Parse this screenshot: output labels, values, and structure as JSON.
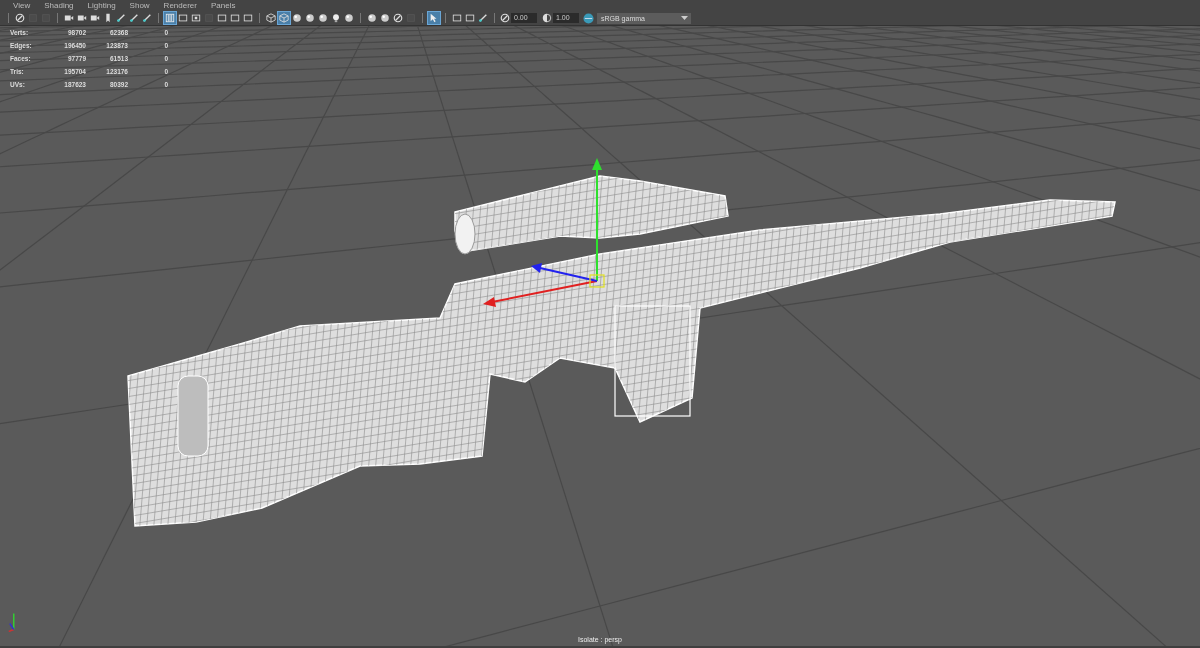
{
  "menu": [
    {
      "label": "View"
    },
    {
      "label": "Shading"
    },
    {
      "label": "Lighting"
    },
    {
      "label": "Show"
    },
    {
      "label": "Renderer"
    },
    {
      "label": "Panels"
    }
  ],
  "toolbar": {
    "groups": [
      [
        {
          "kind": "circle",
          "selected": false
        },
        {
          "kind": "dim",
          "selected": false
        },
        {
          "kind": "dim",
          "selected": false
        }
      ],
      [
        {
          "kind": "camera",
          "selected": false
        },
        {
          "kind": "camera",
          "selected": false
        },
        {
          "kind": "camera",
          "selected": false
        },
        {
          "kind": "bookmark",
          "selected": false
        },
        {
          "kind": "pen",
          "selected": false
        },
        {
          "kind": "pen",
          "selected": false
        },
        {
          "kind": "pen",
          "selected": false
        }
      ],
      [
        {
          "kind": "grid",
          "selected": true
        },
        {
          "kind": "frame",
          "selected": false
        },
        {
          "kind": "target",
          "selected": false
        },
        {
          "kind": "dim",
          "selected": false
        },
        {
          "kind": "frame",
          "selected": false
        },
        {
          "kind": "frame",
          "selected": false
        },
        {
          "kind": "frame",
          "selected": false
        }
      ],
      [
        {
          "kind": "cube",
          "selected": false
        },
        {
          "kind": "cube",
          "selected": true
        },
        {
          "kind": "ball",
          "selected": false
        },
        {
          "kind": "ball",
          "selected": false
        },
        {
          "kind": "ball",
          "selected": false
        },
        {
          "kind": "bulb",
          "selected": false
        },
        {
          "kind": "ball",
          "selected": false
        }
      ],
      [
        {
          "kind": "ball",
          "selected": false
        },
        {
          "kind": "ball",
          "selected": false
        },
        {
          "kind": "circle",
          "selected": false
        },
        {
          "kind": "dim",
          "selected": false
        }
      ],
      [
        {
          "kind": "cursor",
          "selected": true
        }
      ],
      [
        {
          "kind": "frame",
          "selected": false
        },
        {
          "kind": "frame",
          "selected": false
        },
        {
          "kind": "pen",
          "selected": false
        }
      ]
    ],
    "exposure": "0.00",
    "gamma": "1.00",
    "color_space": "sRGB gamma"
  },
  "stats": [
    {
      "label": "Verts:",
      "values": [
        "98702",
        "62368",
        "0"
      ]
    },
    {
      "label": "Edges:",
      "values": [
        "196450",
        "123873",
        "0"
      ]
    },
    {
      "label": "Faces:",
      "values": [
        "97779",
        "61513",
        "0"
      ]
    },
    {
      "label": "Tris:",
      "values": [
        "195704",
        "123176",
        "0"
      ]
    },
    {
      "label": "UVs:",
      "values": [
        "187623",
        "80392",
        "0"
      ]
    }
  ],
  "footer": "Isolate : persp"
}
